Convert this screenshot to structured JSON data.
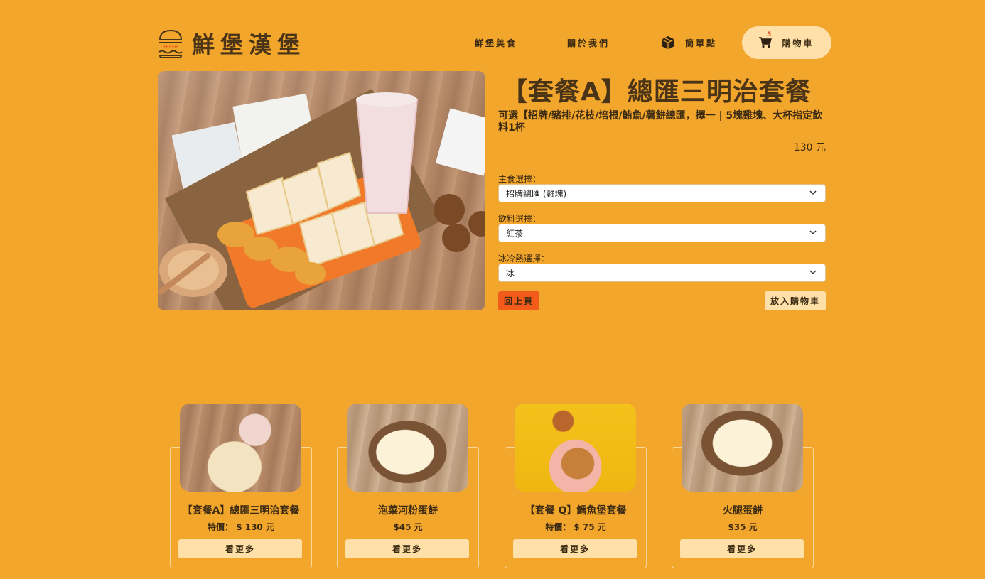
{
  "brand": {
    "name": "鮮堡漢堡",
    "logo_word": "FRESH"
  },
  "nav": {
    "food": "鮮堡美食",
    "about": "關於我們",
    "simple_order": "簡單點",
    "cart": "購物車",
    "cart_count": "5"
  },
  "product": {
    "title": "【套餐A】總匯三明治套餐",
    "description": "可選【招牌/豬排/花枝/培根/鮪魚/薯餅總匯，擇一 | 5塊雞塊、大杯指定飲料1杯",
    "price": "130 元",
    "options": [
      {
        "label": "主食選擇：",
        "value": "招牌總匯 (雞塊)"
      },
      {
        "label": "飲料選擇：",
        "value": "紅茶"
      },
      {
        "label": "冰冷熱選擇：",
        "value": "冰"
      }
    ],
    "back_button": "回上頁",
    "add_button": "放入購物車"
  },
  "recommendations": [
    {
      "name": "【套餐A】總匯三明治套餐",
      "price": "特價： $ 130 元",
      "button": "看更多"
    },
    {
      "name": "泡菜河粉蛋餅",
      "price": "$45 元",
      "button": "看更多"
    },
    {
      "name": "【套餐 Q】鱈魚堡套餐",
      "price": "特價： $ 75 元",
      "button": "看更多"
    },
    {
      "name": "火腿蛋餅",
      "price": "$35 元",
      "button": "看更多"
    }
  ],
  "colors": {
    "background": "#f3a62c",
    "accent_light": "#ffe0a8",
    "accent_red": "#f25b1a",
    "text": "#3b2a12"
  }
}
